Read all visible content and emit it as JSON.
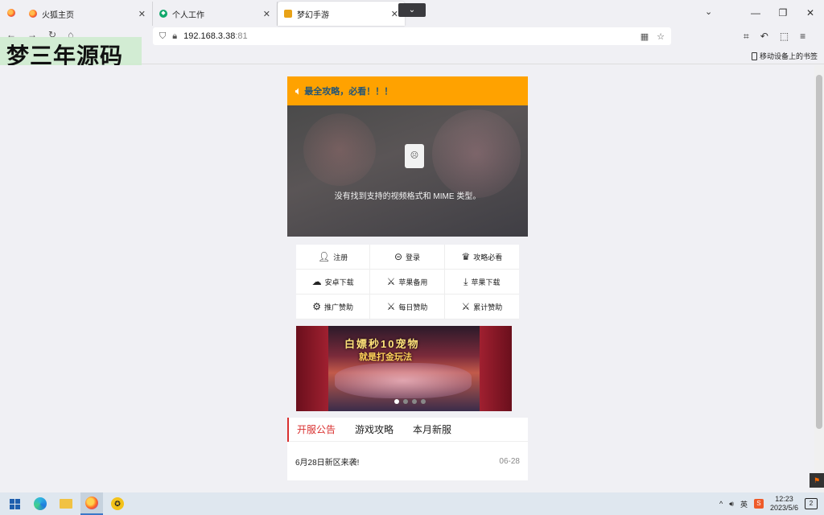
{
  "browser": {
    "tabs": [
      {
        "label": "火狐主页",
        "close": "✕"
      },
      {
        "label": "个人工作",
        "close": "✕"
      },
      {
        "label": "梦幻手游",
        "close": "✕"
      }
    ],
    "tab_dropdown": "⌄",
    "list_tabs": "⌄",
    "window_controls": {
      "minimize": "—",
      "restore": "❐",
      "close": "✕"
    },
    "nav": {
      "back": "←",
      "forward": "→",
      "reload": "↻",
      "home": "⌂"
    },
    "url": {
      "host": "192.168.3.38",
      "port": ":81"
    },
    "url_icons": {
      "shield": "⛉",
      "lock": "🔒︎",
      "qr": "▦",
      "star": "☆"
    },
    "toolbar_right": {
      "crop": "⌗",
      "undo": "↶",
      "extensions": "⬚",
      "menu": "≡"
    },
    "mobile_bookmarks": "移动设备上的书签"
  },
  "watermark": "梦三年源码",
  "page": {
    "notice": "最全攻略，必看！！！",
    "notice_icon": "🔈︎",
    "video_message": "没有找到支持的视频格式和 MIME 类型。",
    "video_icon": "☹",
    "menu": [
      {
        "icon": "👤︎",
        "label": "注册"
      },
      {
        "icon": "⊝",
        "label": "登录"
      },
      {
        "icon": "♛",
        "label": "攻略必看"
      },
      {
        "icon": "☁",
        "label": "安卓下载"
      },
      {
        "icon": "⚔",
        "label": "苹果备用"
      },
      {
        "icon": "⤓",
        "label": "苹果下载"
      },
      {
        "icon": "⚙",
        "label": "推广赞助"
      },
      {
        "icon": "⚔",
        "label": "每日赞助"
      },
      {
        "icon": "⚔",
        "label": "累计赞助"
      }
    ],
    "banner": {
      "title": "白嫖秒10宠物",
      "subtitle": "就是打金玩法"
    },
    "news": {
      "tabs": [
        "开服公告",
        "游戏攻略",
        "本月新服"
      ],
      "active_tab": 0,
      "items": [
        {
          "title": "6月28日新区来袭!",
          "date": "06-28"
        }
      ]
    }
  },
  "taskbar": {
    "other_app": "✪",
    "tray_up": "^",
    "volume": "🔊︎",
    "ime": "英",
    "sogou": "S",
    "time": "12:23",
    "date": "2023/5/6",
    "notifications": "2"
  }
}
